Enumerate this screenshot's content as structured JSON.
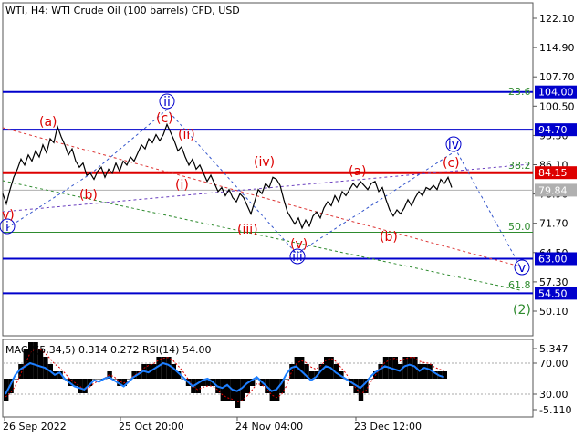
{
  "header": {
    "title": "WTI, H4:  WTI Crude Oil (100 barrels) CFD, USD"
  },
  "chart_data": {
    "type": "line",
    "price_ticks": [
      "122.10",
      "114.90",
      "107.70",
      "100.50",
      "93.30",
      "86.10",
      "78.90",
      "71.70",
      "64.50",
      "57.30",
      "50.10"
    ],
    "levels": [
      {
        "value": "104.00",
        "color": "#0000cc"
      },
      {
        "value": "94.70",
        "color": "#0000cc"
      },
      {
        "value": "84.15",
        "color": "#dd0000"
      },
      {
        "value": "79.84",
        "color": "#b0b0b0"
      },
      {
        "value": "63.00",
        "color": "#0000cc"
      },
      {
        "value": "54.50",
        "color": "#0000cc"
      }
    ],
    "fib_labels": [
      "23.6",
      "38.2",
      "50.0",
      "61.8"
    ],
    "wave_labels": [
      "(a)",
      "(b)",
      "ii",
      "(c)",
      "(ii)",
      "(i)",
      "(iv)",
      "(iii)",
      "(v)",
      "iii",
      "(a)",
      "(b)",
      "iv",
      "(c)",
      "v",
      "(2)",
      "i",
      "v)"
    ],
    "x_labels": [
      "26 Sep 2022",
      "25 Oct 20:00",
      "24 Nov 04:00",
      "23 Dec 12:00"
    ],
    "price_series": [
      [
        0,
        79.0
      ],
      [
        4,
        76.5
      ],
      [
        8,
        80.0
      ],
      [
        12,
        83.0
      ],
      [
        16,
        85.0
      ],
      [
        20,
        87.5
      ],
      [
        24,
        86.0
      ],
      [
        28,
        88.5
      ],
      [
        32,
        87.0
      ],
      [
        36,
        89.5
      ],
      [
        40,
        88.0
      ],
      [
        44,
        91.0
      ],
      [
        48,
        89.0
      ],
      [
        52,
        92.5
      ],
      [
        56,
        91.5
      ],
      [
        60,
        95.5
      ],
      [
        64,
        93.0
      ],
      [
        68,
        91.0
      ],
      [
        72,
        88.5
      ],
      [
        76,
        90.0
      ],
      [
        80,
        87.0
      ],
      [
        84,
        85.5
      ],
      [
        88,
        86.5
      ],
      [
        92,
        83.5
      ],
      [
        96,
        84.0
      ],
      [
        100,
        82.5
      ],
      [
        104,
        84.5
      ],
      [
        108,
        85.5
      ],
      [
        112,
        83.0
      ],
      [
        116,
        85.0
      ],
      [
        120,
        84.0
      ],
      [
        124,
        86.5
      ],
      [
        128,
        84.5
      ],
      [
        132,
        87.0
      ],
      [
        136,
        86.0
      ],
      [
        140,
        88.0
      ],
      [
        144,
        87.0
      ],
      [
        148,
        89.0
      ],
      [
        152,
        91.0
      ],
      [
        156,
        90.0
      ],
      [
        160,
        92.5
      ],
      [
        164,
        91.5
      ],
      [
        168,
        93.5
      ],
      [
        172,
        92.0
      ],
      [
        176,
        93.5
      ],
      [
        180,
        96.0
      ],
      [
        184,
        94.0
      ],
      [
        188,
        92.0
      ],
      [
        192,
        89.5
      ],
      [
        196,
        90.5
      ],
      [
        200,
        88.0
      ],
      [
        204,
        86.0
      ],
      [
        208,
        87.5
      ],
      [
        212,
        85.0
      ],
      [
        216,
        86.0
      ],
      [
        220,
        84.0
      ],
      [
        224,
        82.0
      ],
      [
        228,
        83.5
      ],
      [
        232,
        81.5
      ],
      [
        236,
        79.5
      ],
      [
        240,
        80.5
      ],
      [
        244,
        78.5
      ],
      [
        248,
        80.0
      ],
      [
        252,
        78.0
      ],
      [
        256,
        77.0
      ],
      [
        260,
        79.0
      ],
      [
        264,
        78.0
      ],
      [
        268,
        76.0
      ],
      [
        272,
        74.0
      ],
      [
        276,
        77.0
      ],
      [
        280,
        80.0
      ],
      [
        284,
        79.0
      ],
      [
        288,
        81.5
      ],
      [
        292,
        80.5
      ],
      [
        296,
        83.0
      ],
      [
        300,
        82.5
      ],
      [
        304,
        81.0
      ],
      [
        308,
        77.5
      ],
      [
        312,
        74.5
      ],
      [
        316,
        73.0
      ],
      [
        320,
        71.5
      ],
      [
        324,
        73.0
      ],
      [
        328,
        70.5
      ],
      [
        332,
        72.5
      ],
      [
        336,
        71.0
      ],
      [
        340,
        73.5
      ],
      [
        344,
        74.5
      ],
      [
        348,
        73.0
      ],
      [
        352,
        75.5
      ],
      [
        356,
        77.0
      ],
      [
        360,
        76.0
      ],
      [
        364,
        78.5
      ],
      [
        368,
        77.0
      ],
      [
        372,
        79.5
      ],
      [
        376,
        78.5
      ],
      [
        380,
        80.0
      ],
      [
        384,
        81.5
      ],
      [
        388,
        80.5
      ],
      [
        392,
        82.0
      ],
      [
        396,
        81.0
      ],
      [
        400,
        80.0
      ],
      [
        404,
        81.5
      ],
      [
        408,
        82.0
      ],
      [
        412,
        79.5
      ],
      [
        416,
        80.5
      ],
      [
        420,
        77.5
      ],
      [
        424,
        75.0
      ],
      [
        428,
        73.5
      ],
      [
        432,
        75.0
      ],
      [
        436,
        74.0
      ],
      [
        440,
        75.5
      ],
      [
        444,
        77.5
      ],
      [
        448,
        76.0
      ],
      [
        452,
        78.0
      ],
      [
        456,
        79.5
      ],
      [
        460,
        78.5
      ],
      [
        464,
        80.5
      ],
      [
        468,
        80.0
      ],
      [
        472,
        81.0
      ],
      [
        476,
        80.0
      ],
      [
        480,
        82.5
      ],
      [
        484,
        81.5
      ],
      [
        488,
        83.0
      ],
      [
        492,
        80.5
      ]
    ],
    "macd": {
      "label": "MACD(5,34,5) 0.314 0.272 RSI(14) 54.00",
      "ticks": [
        "5.347",
        "70.00",
        "30.00",
        "-5.110"
      ],
      "rsi": [
        30,
        42,
        55,
        62,
        66,
        70,
        68,
        66,
        64,
        60,
        55,
        58,
        50,
        45,
        40,
        38,
        36,
        42,
        48,
        46,
        50,
        52,
        48,
        44,
        40,
        46,
        52,
        56,
        60,
        58,
        62,
        66,
        70,
        68,
        64,
        58,
        52,
        46,
        40,
        44,
        48,
        50,
        46,
        40,
        38,
        42,
        36,
        34,
        38,
        44,
        48,
        52,
        46,
        40,
        34,
        36,
        44,
        56,
        64,
        66,
        60,
        54,
        48,
        52,
        60,
        66,
        64,
        58,
        54,
        50,
        46,
        42,
        38,
        44,
        52,
        58,
        62,
        66,
        64,
        62,
        60,
        66,
        68,
        66,
        60,
        64,
        62,
        58,
        54,
        52
      ],
      "hist": [
        -3,
        -2,
        0,
        2,
        4,
        5,
        5,
        4,
        3,
        2,
        1,
        1,
        0,
        -1,
        -1,
        -2,
        -2,
        -1,
        0,
        0,
        0,
        1,
        0,
        -1,
        -1,
        0,
        1,
        1,
        2,
        2,
        2,
        3,
        3,
        3,
        2,
        1,
        0,
        -1,
        -2,
        -2,
        -1,
        -1,
        -1,
        -2,
        -3,
        -3,
        -3,
        -4,
        -3,
        -2,
        -1,
        0,
        -1,
        -2,
        -3,
        -3,
        -2,
        0,
        2,
        3,
        3,
        2,
        1,
        1,
        2,
        3,
        3,
        2,
        1,
        0,
        -1,
        -2,
        -3,
        -2,
        0,
        1,
        2,
        3,
        3,
        3,
        2,
        3,
        3,
        3,
        2,
        2,
        2,
        1,
        1,
        1
      ],
      "signal": [
        -2.5,
        -2,
        -1,
        0.5,
        2,
        3.5,
        4,
        4,
        3.5,
        2.8,
        2,
        1.5,
        0.8,
        0,
        -0.5,
        -1,
        -1.5,
        -1.2,
        -0.6,
        -0.3,
        0,
        0.5,
        0.3,
        -0.3,
        -0.6,
        -0.3,
        0.4,
        0.8,
        1.4,
        1.8,
        2,
        2.5,
        2.8,
        2.9,
        2.5,
        1.8,
        1,
        0,
        -1,
        -1.5,
        -1.2,
        -1,
        -1,
        -1.5,
        -2.2,
        -2.6,
        -2.8,
        -3.2,
        -3,
        -2.4,
        -1.6,
        -0.7,
        -0.8,
        -1.4,
        -2.2,
        -2.6,
        -2.2,
        -1,
        0.8,
        2,
        2.5,
        2.2,
        1.6,
        1.3,
        1.8,
        2.5,
        2.8,
        2.4,
        1.6,
        0.8,
        -0.2,
        -1.2,
        -2,
        -1.8,
        -0.6,
        0.4,
        1.4,
        2.2,
        2.6,
        2.8,
        2.4,
        2.7,
        2.9,
        2.9,
        2.4,
        2.2,
        2.1,
        1.6,
        1.3,
        1.1
      ]
    },
    "colors": {
      "price": "#000000",
      "fib": "#2e8b2e",
      "wave_red": "#dd0000",
      "wave_blue": "#0000cc",
      "rsi": "#1e7fff"
    }
  }
}
